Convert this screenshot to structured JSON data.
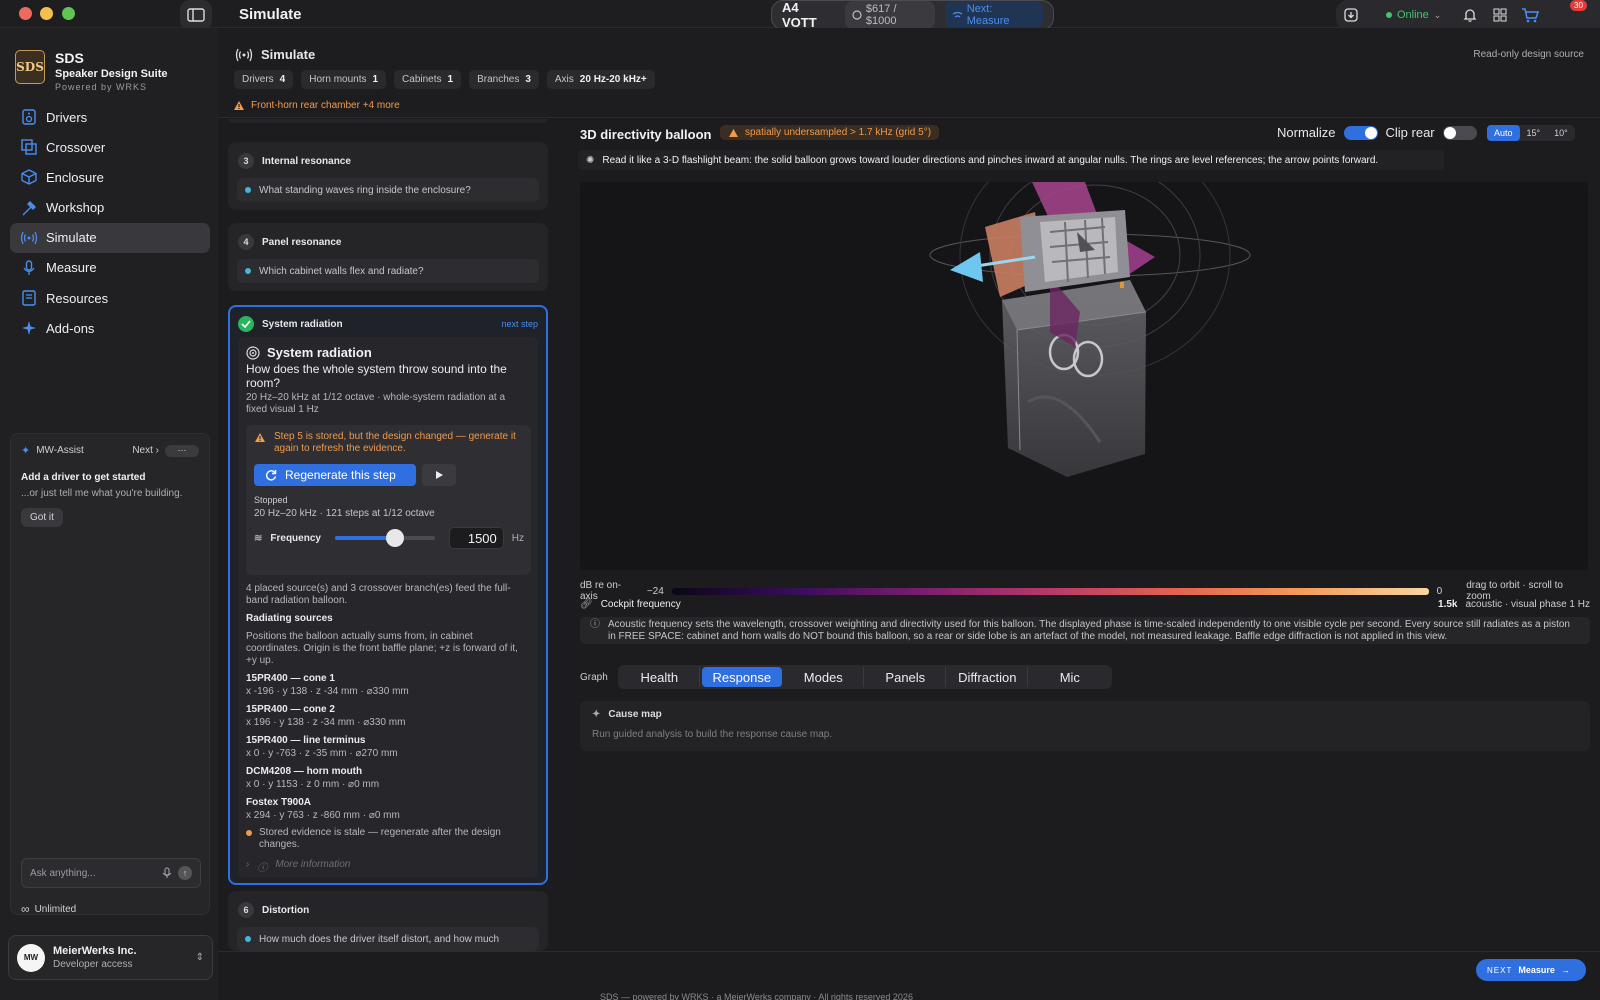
{
  "window": {
    "title": "Simulate",
    "traffic_lights": [
      "#ed6a5e",
      "#f5bf4f",
      "#61c554"
    ]
  },
  "topbar": {
    "project": "A4 VOTT",
    "budget": "$617 / $1000",
    "next": "Next: Measure",
    "status": "Online",
    "cart_count": "30",
    "icons": [
      "sidebar-toggle-icon",
      "download-icon",
      "bell-icon",
      "grid-icon",
      "cart-icon"
    ]
  },
  "brand": {
    "name": "SDS",
    "subtitle": "Speaker Design Suite",
    "powered": "Powered by WRKS",
    "logo_text": "SDS"
  },
  "nav": [
    {
      "label": "Drivers",
      "icon": "speaker-icon"
    },
    {
      "label": "Crossover",
      "icon": "crossover-icon"
    },
    {
      "label": "Enclosure",
      "icon": "cube-icon"
    },
    {
      "label": "Workshop",
      "icon": "hammer-icon"
    },
    {
      "label": "Simulate",
      "icon": "waves-icon",
      "active": true
    },
    {
      "label": "Measure",
      "icon": "microphone-icon"
    },
    {
      "label": "Resources",
      "icon": "book-icon"
    },
    {
      "label": "Add-ons",
      "icon": "sparkle-icon"
    }
  ],
  "assist": {
    "title": "MW-Assist",
    "next": "Next",
    "more": "···",
    "heading": "Add a driver to get started",
    "sub": "...or just tell me what you're building.",
    "got_it": "Got it",
    "ask_placeholder": "Ask anything...",
    "plan": "Unlimited"
  },
  "account": {
    "name": "MeierWerks Inc.",
    "role": "Developer access",
    "avatar": "MW"
  },
  "header": {
    "title": "Simulate",
    "readonly": "Read-only design source",
    "stats": [
      {
        "label": "Drivers",
        "value": "4"
      },
      {
        "label": "Horn mounts",
        "value": "1"
      },
      {
        "label": "Cabinets",
        "value": "1"
      },
      {
        "label": "Branches",
        "value": "3"
      },
      {
        "label": "Axis",
        "value": "20 Hz-20 kHz+"
      }
    ],
    "warning": "Front-horn rear chamber +4 more"
  },
  "steps": {
    "step3": {
      "num": "3",
      "title": "Internal resonance",
      "question": "What standing waves ring inside the enclosure?"
    },
    "step4": {
      "num": "4",
      "title": "Panel resonance",
      "question": "Which cabinet walls flex and radiate?"
    },
    "step5": {
      "title": "System radiation",
      "next_step": "next step",
      "heading": "System radiation",
      "question": "How does the whole system throw sound into the room?",
      "desc": "20 Hz–20 kHz at 1/12 octave · whole-system radiation at a fixed visual 1 Hz",
      "warning": "Step 5 is stored, but the design changed — generate it again to refresh the evidence.",
      "regen": "Regenerate this step",
      "stopped": "Stopped",
      "steps_info": "20 Hz–20 kHz · 121 steps at 1/12 octave",
      "freq_label": "Frequency",
      "freq_value": "1500",
      "freq_unit": "Hz",
      "freq_fraction": 0.6,
      "feed": "4 placed source(s) and 3 crossover branch(es) feed the full-band radiation balloon.",
      "radiating_title": "Radiating sources",
      "radiating_desc": "Positions the balloon actually sums from, in cabinet coordinates. Origin is the front baffle plane; +z is forward of it, +y up.",
      "sources": [
        {
          "name": "15PR400 — cone 1",
          "coord": "x -196 · y 138 · z -34 mm · ⌀330 mm"
        },
        {
          "name": "15PR400 — cone 2",
          "coord": "x 196 · y 138 · z -34 mm · ⌀330 mm"
        },
        {
          "name": "15PR400 — line terminus",
          "coord": "x 0 · y -763 · z -35 mm · ⌀270 mm"
        },
        {
          "name": "DCM4208 — horn mouth",
          "coord": "x 0 · y 1153 · z 0 mm · ⌀0 mm"
        },
        {
          "name": "Fostex T900A",
          "coord": "x 294 · y 763 · z -860 mm · ⌀0 mm"
        }
      ],
      "stale": "Stored evidence is stale — regenerate after the design changes.",
      "more_info": "More information"
    },
    "step6": {
      "num": "6",
      "title": "Distortion",
      "question": "How much does the driver itself distort, and how much"
    }
  },
  "balloon": {
    "title": "3D directivity balloon",
    "badge": "spatially undersampled > 1.7 kHz (grid 5°)",
    "normalize": "Normalize",
    "normalize_on": true,
    "clip_rear": "Clip rear",
    "clip_rear_on": false,
    "resolution": [
      "Auto",
      "15°",
      "10°"
    ],
    "resolution_selected": "Auto",
    "hint": "Read it like a 3-D flashlight beam: the solid balloon grows toward louder directions and pinches inward at angular nulls. The rings are level references; the arrow points forward.",
    "colorbar_label": "dB re on-axis",
    "colorbar_min": "−24",
    "colorbar_max": "0",
    "colorbar_hint": "drag to orbit · scroll to zoom",
    "cockpit": "Cockpit frequency",
    "cockpit_value": "1.5k",
    "cockpit_mode": "acoustic · visual phase 1 Hz",
    "note": "Acoustic frequency sets the wavelength, crossover weighting and directivity used for this balloon. The displayed phase is time-scaled independently to one visible cycle per second. Every source still radiates as a piston in FREE SPACE: cabinet and horn walls do NOT bound this balloon, so a rear or side lobe is an artefact of the model, not measured leakage. Baffle edge diffraction is not applied in this view."
  },
  "graph": {
    "label": "Graph",
    "tabs": [
      "Health",
      "Response",
      "Modes",
      "Panels",
      "Diffraction",
      "Mic"
    ],
    "selected": "Response"
  },
  "cause_map": {
    "title": "Cause map",
    "sub": "Run guided analysis to build the response cause map."
  },
  "footer": {
    "next_prefix": "NEXT",
    "next_label": "Measure",
    "copyright": "SDS — powered by WRKS · a MeierWerks company · All rights reserved 2026"
  },
  "colors": {
    "accent": "#2f6fe0",
    "warning": "#f19a4a",
    "success": "#2ab45e",
    "online": "#44c46a"
  }
}
